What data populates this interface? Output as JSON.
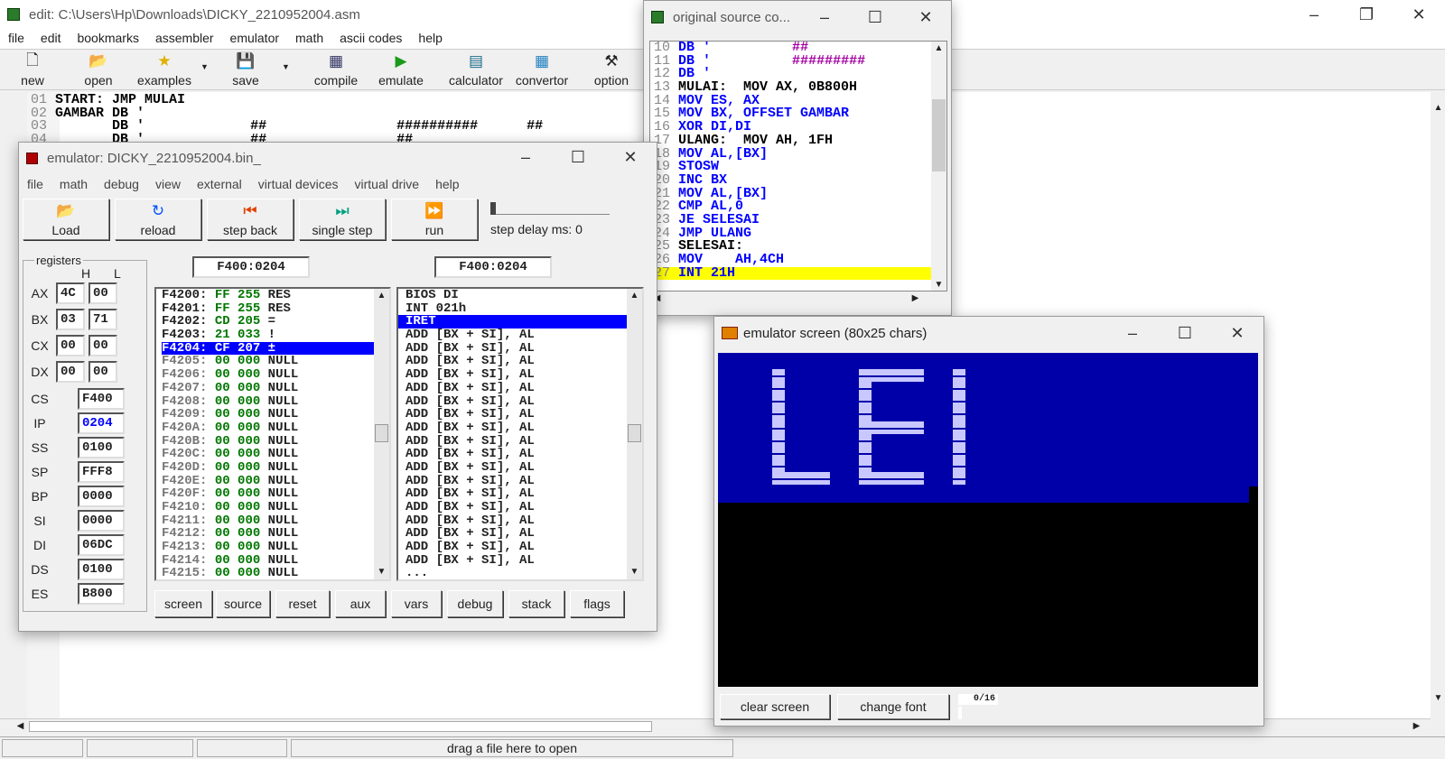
{
  "editor": {
    "title": "edit: C:\\Users\\Hp\\Downloads\\DICKY_2210952004.asm",
    "menu": [
      "file",
      "edit",
      "bookmarks",
      "assembler",
      "emulator",
      "math",
      "ascii codes",
      "help"
    ],
    "toolbar": [
      "new",
      "open",
      "examples",
      "save",
      "compile",
      "emulate",
      "calculator",
      "convertor",
      "option"
    ],
    "lines": [
      {
        "n": "01",
        "t": "START: JMP MULAI"
      },
      {
        "n": "02",
        "t": "GAMBAR DB '"
      },
      {
        "n": "03",
        "t": "       DB '             ##                ##########      ##"
      },
      {
        "n": "04",
        "t": "       DB '             ##                ##"
      }
    ],
    "status": "drag a file here to open"
  },
  "source": {
    "title": "original source co...",
    "lines": [
      {
        "n": "10",
        "t": "DB '",
        "extra": "          ##"
      },
      {
        "n": "11",
        "t": "DB '",
        "extra": "          #########"
      },
      {
        "n": "12",
        "t": "DB '",
        "extra": ""
      },
      {
        "n": "13",
        "t": "MULAI:  MOV AX, 0B800H"
      },
      {
        "n": "14",
        "t": "MOV ES, AX"
      },
      {
        "n": "15",
        "t": "MOV BX, OFFSET GAMBAR"
      },
      {
        "n": "16",
        "t": "XOR DI,DI"
      },
      {
        "n": "17",
        "t": "ULANG:  MOV AH, 1FH"
      },
      {
        "n": "18",
        "t": "MOV AL,[BX]"
      },
      {
        "n": "19",
        "t": "STOSW"
      },
      {
        "n": "20",
        "t": "INC BX"
      },
      {
        "n": "21",
        "t": "MOV AL,[BX]"
      },
      {
        "n": "22",
        "t": "CMP AL,0"
      },
      {
        "n": "23",
        "t": "JE SELESAI"
      },
      {
        "n": "24",
        "t": "JMP ULANG"
      },
      {
        "n": "25",
        "t": "SELESAI:"
      },
      {
        "n": "26",
        "t": "MOV    AH,4CH"
      },
      {
        "n": "27",
        "t": "INT 21H"
      }
    ]
  },
  "emulator": {
    "title": "emulator: DICKY_2210952004.bin_",
    "menu": [
      "file",
      "math",
      "debug",
      "view",
      "external",
      "virtual devices",
      "virtual drive",
      "help"
    ],
    "buttons": [
      "Load",
      "reload",
      "step back",
      "single step",
      "run"
    ],
    "step_delay": "step delay ms: 0",
    "registers_label": "registers",
    "h": "H",
    "l": "L",
    "regs8": [
      {
        "name": "AX",
        "h": "4C",
        "l": "00"
      },
      {
        "name": "BX",
        "h": "03",
        "l": "71"
      },
      {
        "name": "CX",
        "h": "00",
        "l": "00"
      },
      {
        "name": "DX",
        "h": "00",
        "l": "00"
      }
    ],
    "regs16": [
      {
        "name": "CS",
        "v": "F400"
      },
      {
        "name": "IP",
        "v": "0204"
      },
      {
        "name": "SS",
        "v": "0100"
      },
      {
        "name": "SP",
        "v": "FFF8"
      },
      {
        "name": "BP",
        "v": "0000"
      },
      {
        "name": "SI",
        "v": "0000"
      },
      {
        "name": "DI",
        "v": "06DC"
      },
      {
        "name": "DS",
        "v": "0100"
      },
      {
        "name": "ES",
        "v": "B800"
      }
    ],
    "addr_left": "F400:0204",
    "addr_right": "F400:0204",
    "mem": [
      {
        "a": "F4200:",
        "h": "FF",
        "d": "255",
        "c": "RES"
      },
      {
        "a": "F4201:",
        "h": "FF",
        "d": "255",
        "c": "RES"
      },
      {
        "a": "F4202:",
        "h": "CD",
        "d": "205",
        "c": "="
      },
      {
        "a": "F4203:",
        "h": "21",
        "d": "033",
        "c": "!"
      },
      {
        "a": "F4204:",
        "h": "CF",
        "d": "207",
        "c": "±"
      },
      {
        "a": "F4205:",
        "h": "00",
        "d": "000",
        "c": "NULL"
      },
      {
        "a": "F4206:",
        "h": "00",
        "d": "000",
        "c": "NULL"
      },
      {
        "a": "F4207:",
        "h": "00",
        "d": "000",
        "c": "NULL"
      },
      {
        "a": "F4208:",
        "h": "00",
        "d": "000",
        "c": "NULL"
      },
      {
        "a": "F4209:",
        "h": "00",
        "d": "000",
        "c": "NULL"
      },
      {
        "a": "F420A:",
        "h": "00",
        "d": "000",
        "c": "NULL"
      },
      {
        "a": "F420B:",
        "h": "00",
        "d": "000",
        "c": "NULL"
      },
      {
        "a": "F420C:",
        "h": "00",
        "d": "000",
        "c": "NULL"
      },
      {
        "a": "F420D:",
        "h": "00",
        "d": "000",
        "c": "NULL"
      },
      {
        "a": "F420E:",
        "h": "00",
        "d": "000",
        "c": "NULL"
      },
      {
        "a": "F420F:",
        "h": "00",
        "d": "000",
        "c": "NULL"
      },
      {
        "a": "F4210:",
        "h": "00",
        "d": "000",
        "c": "NULL"
      },
      {
        "a": "F4211:",
        "h": "00",
        "d": "000",
        "c": "NULL"
      },
      {
        "a": "F4212:",
        "h": "00",
        "d": "000",
        "c": "NULL"
      },
      {
        "a": "F4213:",
        "h": "00",
        "d": "000",
        "c": "NULL"
      },
      {
        "a": "F4214:",
        "h": "00",
        "d": "000",
        "c": "NULL"
      },
      {
        "a": "F4215:",
        "h": "00",
        "d": "000",
        "c": "NULL"
      }
    ],
    "disasm": [
      "BIOS DI",
      "INT 021h",
      "IRET",
      "ADD [BX + SI], AL",
      "ADD [BX + SI], AL",
      "ADD [BX + SI], AL",
      "ADD [BX + SI], AL",
      "ADD [BX + SI], AL",
      "ADD [BX + SI], AL",
      "ADD [BX + SI], AL",
      "ADD [BX + SI], AL",
      "ADD [BX + SI], AL",
      "ADD [BX + SI], AL",
      "ADD [BX + SI], AL",
      "ADD [BX + SI], AL",
      "ADD [BX + SI], AL",
      "ADD [BX + SI], AL",
      "ADD [BX + SI], AL",
      "ADD [BX + SI], AL",
      "ADD [BX + SI], AL",
      "ADD [BX + SI], AL",
      "..."
    ],
    "bottom": [
      "screen",
      "source",
      "reset",
      "aux",
      "vars",
      "debug",
      "stack",
      "flags"
    ]
  },
  "screen": {
    "title": "emulator screen (80x25 chars)",
    "letters": "LEI",
    "buttons": [
      "clear screen",
      "change font"
    ],
    "counter": "0/16"
  },
  "colors": {
    "blue": "#0000ff",
    "screen_blue": "#0000a8",
    "highlight": "#ffff00"
  }
}
